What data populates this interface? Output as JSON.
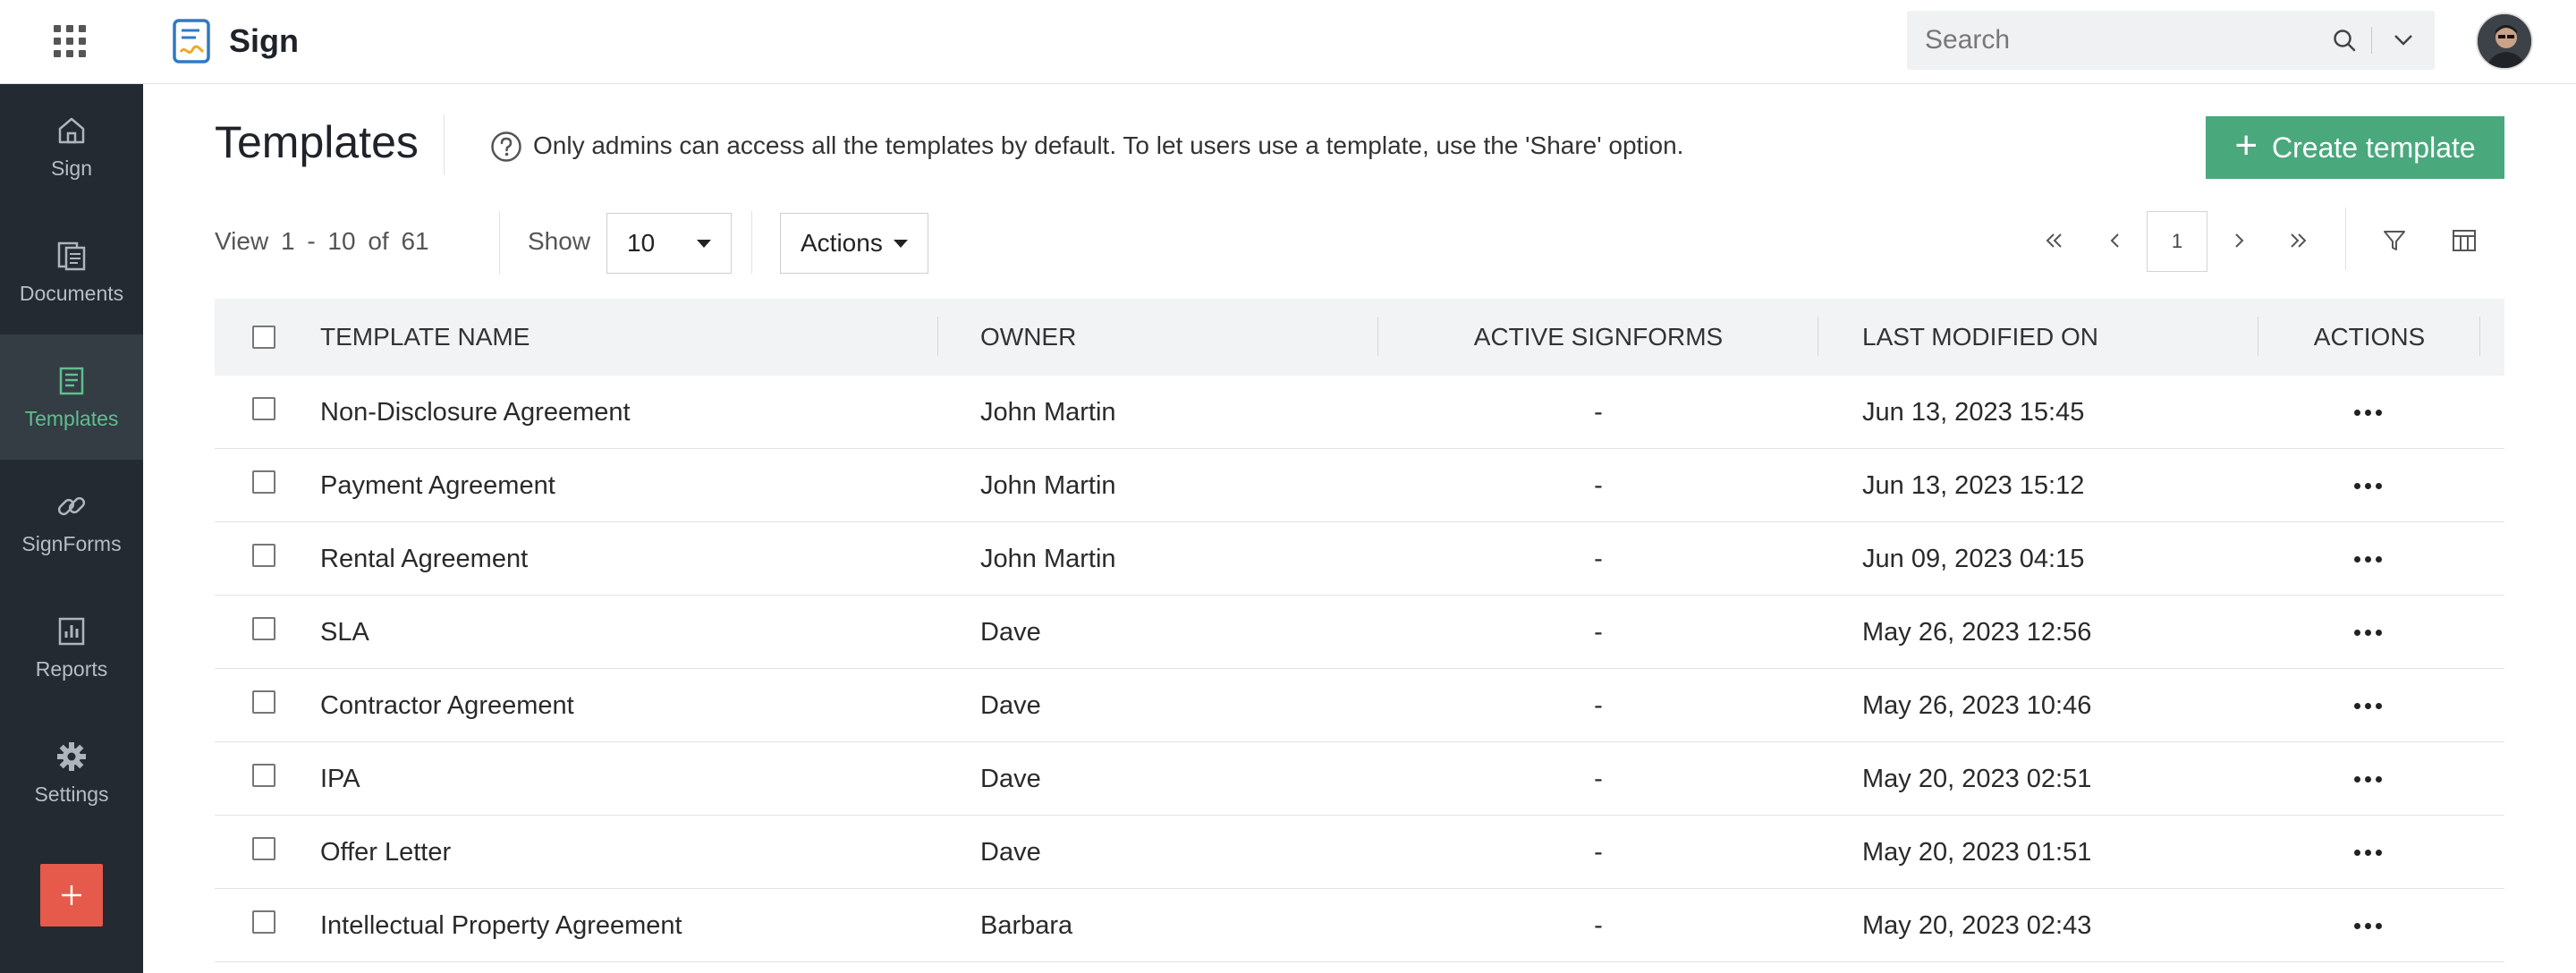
{
  "app": {
    "name": "Sign"
  },
  "search": {
    "placeholder": "Search"
  },
  "sidebar": {
    "items": [
      {
        "label": "Sign",
        "icon": "home-icon"
      },
      {
        "label": "Documents",
        "icon": "documents-icon"
      },
      {
        "label": "Templates",
        "icon": "templates-icon",
        "active": true
      },
      {
        "label": "SignForms",
        "icon": "link-icon"
      },
      {
        "label": "Reports",
        "icon": "reports-icon"
      },
      {
        "label": "Settings",
        "icon": "gear-icon"
      }
    ],
    "add_label": "+"
  },
  "page": {
    "title": "Templates",
    "info": "Only admins can access all the templates by default. To let users use a template, use the 'Share' option.",
    "create_label": "Create template"
  },
  "toolbar": {
    "view_text": "View 1 - 10 of 61",
    "show_label": "Show",
    "page_size": "10",
    "actions_label": "Actions",
    "current_page": "1"
  },
  "table": {
    "columns": [
      "TEMPLATE NAME",
      "OWNER",
      "ACTIVE SIGNFORMS",
      "LAST MODIFIED ON",
      "ACTIONS"
    ],
    "rows": [
      {
        "name": "Non-Disclosure Agreement",
        "owner": "John Martin",
        "signforms": "-",
        "modified": "Jun 13, 2023 15:45"
      },
      {
        "name": "Payment Agreement",
        "owner": "John Martin",
        "signforms": "-",
        "modified": "Jun 13, 2023 15:12"
      },
      {
        "name": "Rental Agreement",
        "owner": "John Martin",
        "signforms": "-",
        "modified": "Jun 09, 2023 04:15"
      },
      {
        "name": "SLA",
        "owner": "Dave",
        "signforms": "-",
        "modified": "May 26, 2023 12:56"
      },
      {
        "name": "Contractor Agreement",
        "owner": "Dave",
        "signforms": "-",
        "modified": "May 26, 2023 10:46"
      },
      {
        "name": "IPA",
        "owner": "Dave",
        "signforms": "-",
        "modified": "May 20, 2023 02:51"
      },
      {
        "name": "Offer Letter",
        "owner": "Dave",
        "signforms": "-",
        "modified": "May 20, 2023 01:51"
      },
      {
        "name": "Intellectual Property Agreement",
        "owner": "Barbara",
        "signforms": "-",
        "modified": "May 20, 2023 02:43"
      }
    ]
  },
  "colors": {
    "accent": "#4aa87d",
    "sidebar_bg": "#232a31",
    "sidebar_active": "#5fbf8f",
    "add_button": "#e55a4b"
  }
}
